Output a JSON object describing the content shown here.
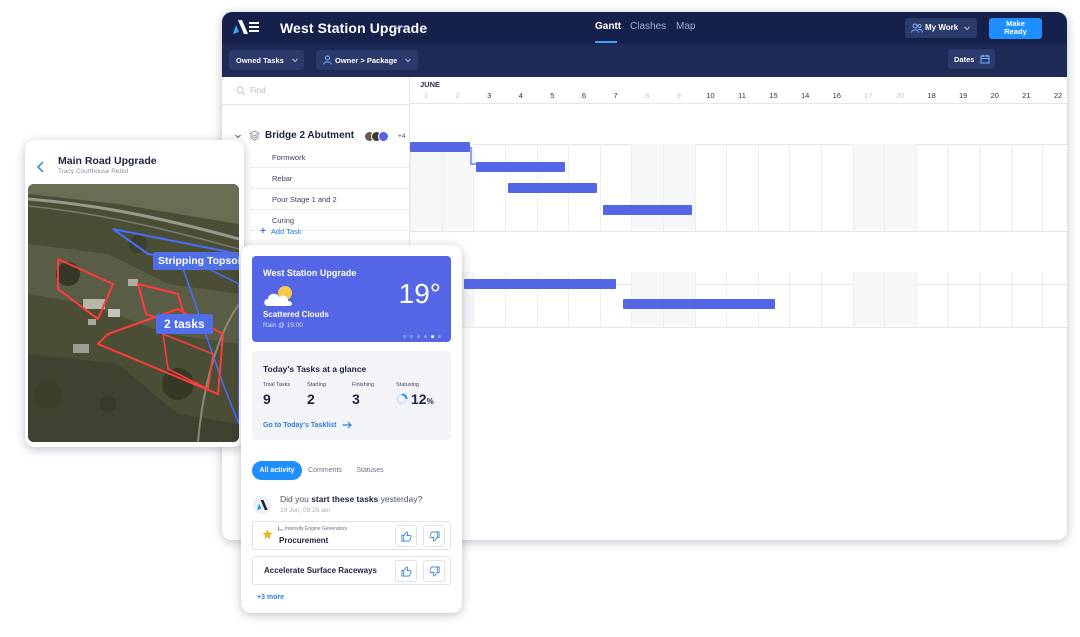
{
  "desktop": {
    "project_title": "West Station Upgrade",
    "nav_tabs": [
      "Gantt",
      "Clashes",
      "Map"
    ],
    "active_tab": "Gantt",
    "my_work_label": "My Work",
    "make_ready_label": [
      "Make",
      "Ready"
    ],
    "filters": {
      "owned_tasks": "Owned Tasks",
      "owner_package": "Owner > Package",
      "dates": "Dates"
    },
    "search_placeholder": "Find",
    "group": {
      "title": "Bridge 2 Abutment",
      "extra_members": "+4"
    },
    "tasks": [
      "Formwork",
      "Rebar",
      "Pour Stage 1 and 2",
      "Curing"
    ],
    "add_task_label": "Add Task",
    "gantt": {
      "month": "JUNE",
      "days": [
        "1",
        "2",
        "3",
        "4",
        "5",
        "6",
        "7",
        "8",
        "9",
        "10",
        "11",
        "15",
        "14",
        "16",
        "17",
        "20",
        "18",
        "19",
        "20",
        "21",
        "22"
      ],
      "light_days": [
        0,
        1,
        7,
        8,
        14,
        15
      ]
    }
  },
  "tablet": {
    "title": "Main Road Upgrade",
    "subtitle": "Tracy Courthouse Rebid",
    "map_labels": {
      "topsoil": "Stripping Topsoil",
      "tasks": "2 tasks"
    }
  },
  "phone": {
    "weather": {
      "project": "West Station Upgrade",
      "temperature": "19°",
      "condition": "Scattered Clouds",
      "rain": "Rain @ 15:00"
    },
    "glance": {
      "title": "Today's Tasks at a glance",
      "stats": [
        {
          "label": "Total Tasks",
          "value": "9"
        },
        {
          "label": "Starting",
          "value": "2"
        },
        {
          "label": "Finishing",
          "value": "3"
        },
        {
          "label": "Statusing",
          "value": "12",
          "unit": "%"
        }
      ],
      "statusing_fraction": 0.12,
      "link": "Go to Today's Tasklist"
    },
    "tabs": [
      "All activity",
      "Comments",
      "Statuses"
    ],
    "activity": {
      "q_pre": "Did you ",
      "q_bold": "start these tasks",
      "q_post": " yesterday?",
      "time": "19 Jun, 09:25 am"
    },
    "cards": [
      {
        "subtitle": "Intensify Engine Generators",
        "title": "Procurement"
      },
      {
        "title": "Accelerate Surface Raceways"
      }
    ],
    "more_label": "+3 more"
  }
}
